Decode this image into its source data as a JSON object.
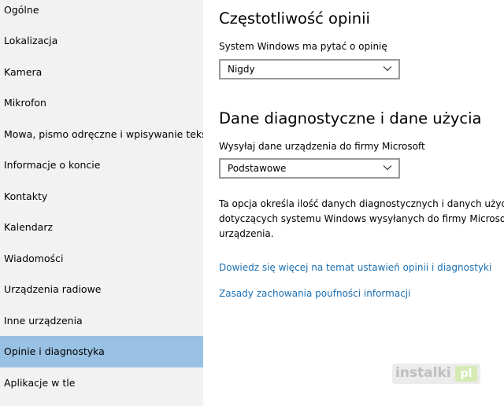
{
  "sidebar": {
    "items": [
      {
        "label": "Ogólne"
      },
      {
        "label": "Lokalizacja"
      },
      {
        "label": "Kamera"
      },
      {
        "label": "Mikrofon"
      },
      {
        "label": "Mowa, pismo odręczne i wpisywanie tekstu"
      },
      {
        "label": "Informacje o koncie"
      },
      {
        "label": "Kontakty"
      },
      {
        "label": "Kalendarz"
      },
      {
        "label": "Wiadomości"
      },
      {
        "label": "Urządzenia radiowe"
      },
      {
        "label": "Inne urządzenia"
      },
      {
        "label": "Opinie i diagnostyka",
        "selected": true
      },
      {
        "label": "Aplikacje w tle"
      }
    ]
  },
  "feedback": {
    "heading": "Częstotliwość opinii",
    "label": "System Windows ma pytać o opinię",
    "dropdown_value": "Nigdy"
  },
  "diagnostics": {
    "heading": "Dane diagnostyczne i dane użycia",
    "label": "Wysyłaj dane urządzenia do firmy Microsoft",
    "dropdown_value": "Podstawowe",
    "description_lines": [
      "Ta opcja określa ilość danych diagnostycznych i danych użycia",
      "dotyczących systemu Windows wysyłanych do firmy Microsoft z",
      "urządzenia."
    ]
  },
  "links": {
    "learn_more": "Dowiedz się więcej na temat ustawień opinii i diagnostyki",
    "privacy": "Zasady zachowania poufności informacji"
  },
  "watermark": {
    "text": "instalki",
    "badge": "pl"
  },
  "colors": {
    "sidebar_bg": "#f2f2f2",
    "selected_bg": "#98c1e3",
    "link": "#1a6fb3",
    "dropdown_border": "#999999"
  }
}
